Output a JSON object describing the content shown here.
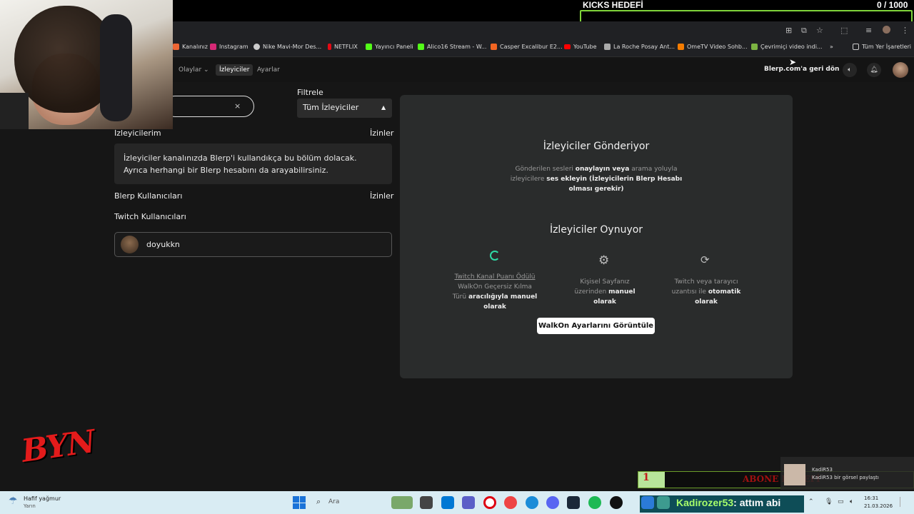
{
  "overlay": {
    "kicks_title": "KICKS HEDEFİ",
    "kicks_count": "0 / 1000",
    "abone_num": "1",
    "abone_text": "ABONE HEDEFİ",
    "logo_text": "BYN",
    "notification": {
      "name": "KadiR53",
      "message": "KadiR53 bir görsel paylaştı"
    },
    "chat_line": {
      "user": "Kadirozer53",
      "message": ": attım abi"
    }
  },
  "bookmarks": [
    "Kanalınız",
    "Instagram",
    "Nike Mavi-Mor Des...",
    "NETFLIX",
    "Yayıncı Paneli",
    "Alico16 Stream - W...",
    "Casper Excalibur E2...",
    "YouTube",
    "La Roche Posay Ant...",
    "OmeTV Video Sohb...",
    "Çevrimiçi video indi...",
    "»",
    "Tüm Yer İşaretleri"
  ],
  "nav": {
    "tabs": [
      "Olaylar ⌄",
      "İzleyiciler",
      "Ayarlar"
    ],
    "back_link": "Blerp.com'a geri dön"
  },
  "left": {
    "search_clear": "×",
    "filter_label": "Filtrele",
    "filter_value": "Tüm İzleyiciler",
    "my_viewers": "İzleyicilerim",
    "permissions": "İzinler",
    "info": "İzleyiciler kanalınızda Blerp'i kullandıkça bu bölüm dolacak. Ayrıca herhangi bir Blerp hesabını da arayabilirsiniz.",
    "blerp_users": "Blerp Kullanıcıları",
    "permissions2": "İzinler",
    "twitch_users": "Twitch Kullanıcıları",
    "user": "doyukkn"
  },
  "panel": {
    "heading1": "İzleyiciler Gönderiyor",
    "send_a": "Gönderilen sesleri ",
    "send_b": "onaylayın veya",
    "send_c": " arama yoluyla izleyicilere ",
    "send_d": "ses ekleyin (İzleyicilerin Blerp Hesabı olması gerekir)",
    "heading2": "İzleyiciler Oynuyor",
    "col1_a": "Twitch Kanal Puanı Ödülü",
    "col1_b": " WalkOn Geçersiz Kılma Türü ",
    "col1_c": "aracılığıyla manuel olarak",
    "col2_a": "Kişisel Sayfanız üzerinden ",
    "col2_b": "manuel olarak",
    "col3_a": "Twitch veya tarayıcı uzantısı ile ",
    "col3_b": "otomatik olarak",
    "button": "WalkOn Ayarlarını Görüntüle"
  },
  "taskbar": {
    "weather_title": "Hafif yağmur",
    "weather_sub": "Yarın",
    "search": "Ara",
    "time": "16:31",
    "date": "21.03.2026"
  }
}
